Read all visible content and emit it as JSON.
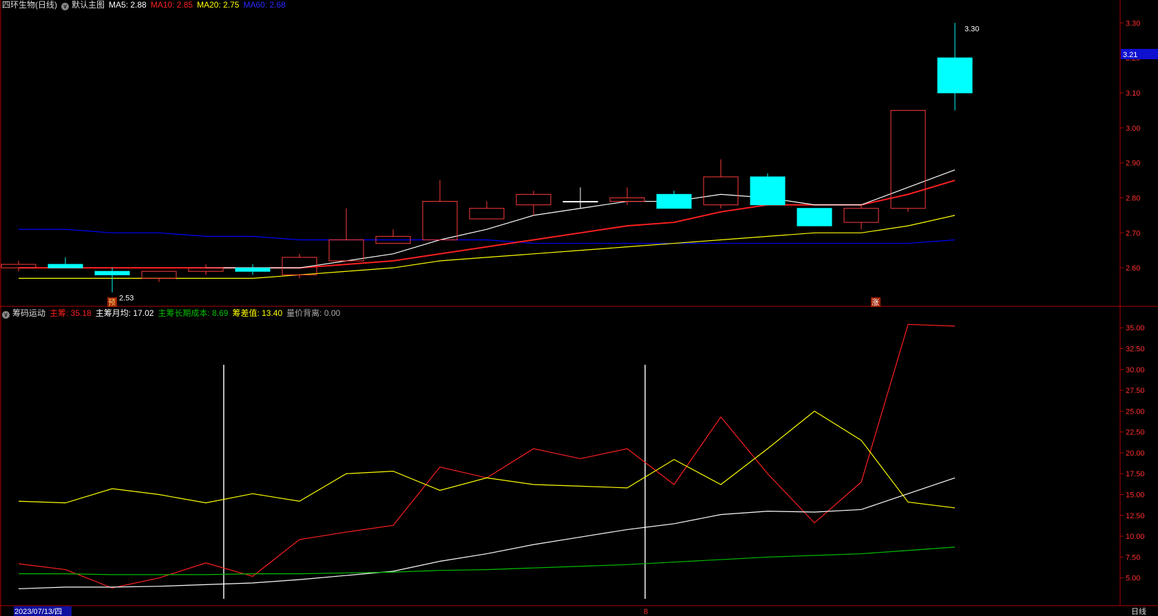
{
  "colors": {
    "bg": "#000000",
    "frame": "#b00000",
    "up": "#ff3b3b",
    "down": "#00ffff",
    "ma5": "#ffffff",
    "ma10": "#ff2020",
    "ma20": "#ffff00",
    "ma60": "#0000ff",
    "main_chip": "#ff2020",
    "monthly_avg": "#ffffff",
    "long_cost": "#00c000",
    "chip_diff": "#ffff00",
    "divergence": "#bbbbbb"
  },
  "header": {
    "title": "四环生物(日线)",
    "template": "默认主图",
    "ma5_label": "MA5: 2.88",
    "ma10_label": "MA10: 2.85",
    "ma20_label": "MA20: 2.75",
    "ma60_label": "MA60: 2.68"
  },
  "sub_header": {
    "indicator": "筹码运动",
    "main_chip_label": "主筹: 35.18",
    "monthly_avg_label": "主筹月均: 17.02",
    "long_cost_label": "主筹长期成本: 8.69",
    "chip_diff_label": "筹差值: 13.40",
    "divergence_label": "量价背离: 0.00"
  },
  "footer": {
    "start_date": "2023/07/13/四",
    "month_marker": "8",
    "period": "日线"
  },
  "markers": {
    "low_label": "2.53",
    "high_label": "3.30",
    "pre_tag": "预",
    "rise_tag": "涨",
    "current_price": "3.21"
  },
  "chart_data": [
    {
      "type": "candlestick",
      "title": "四环生物(日线)",
      "ylim": [
        2.5,
        3.33
      ],
      "y_ticks": [
        2.6,
        2.7,
        2.8,
        2.9,
        3.0,
        3.1,
        3.2,
        3.3
      ],
      "candles": [
        {
          "o": 2.6,
          "h": 2.62,
          "l": 2.59,
          "c": 2.61
        },
        {
          "o": 2.61,
          "h": 2.63,
          "l": 2.6,
          "c": 2.6
        },
        {
          "o": 2.59,
          "h": 2.6,
          "l": 2.53,
          "c": 2.58
        },
        {
          "o": 2.57,
          "h": 2.59,
          "l": 2.56,
          "c": 2.59
        },
        {
          "o": 2.59,
          "h": 2.61,
          "l": 2.58,
          "c": 2.6
        },
        {
          "o": 2.6,
          "h": 2.61,
          "l": 2.58,
          "c": 2.59
        },
        {
          "o": 2.58,
          "h": 2.64,
          "l": 2.57,
          "c": 2.63
        },
        {
          "o": 2.62,
          "h": 2.77,
          "l": 2.62,
          "c": 2.68
        },
        {
          "o": 2.67,
          "h": 2.71,
          "l": 2.67,
          "c": 2.69
        },
        {
          "o": 2.68,
          "h": 2.85,
          "l": 2.68,
          "c": 2.79
        },
        {
          "o": 2.74,
          "h": 2.79,
          "l": 2.74,
          "c": 2.77
        },
        {
          "o": 2.78,
          "h": 2.82,
          "l": 2.75,
          "c": 2.81
        },
        {
          "o": 2.79,
          "h": 2.83,
          "l": 2.77,
          "c": 2.79
        },
        {
          "o": 2.79,
          "h": 2.83,
          "l": 2.78,
          "c": 2.8
        },
        {
          "o": 2.81,
          "h": 2.82,
          "l": 2.77,
          "c": 2.77
        },
        {
          "o": 2.78,
          "h": 2.91,
          "l": 2.77,
          "c": 2.86
        },
        {
          "o": 2.86,
          "h": 2.87,
          "l": 2.78,
          "c": 2.78
        },
        {
          "o": 2.77,
          "h": 2.77,
          "l": 2.72,
          "c": 2.72
        },
        {
          "o": 2.73,
          "h": 2.78,
          "l": 2.71,
          "c": 2.77
        },
        {
          "o": 2.77,
          "h": 3.05,
          "l": 2.76,
          "c": 3.05
        },
        {
          "o": 3.2,
          "h": 3.3,
          "l": 3.05,
          "c": 3.1
        }
      ],
      "ma5": [
        null,
        null,
        null,
        null,
        2.6,
        2.6,
        2.6,
        2.62,
        2.64,
        2.68,
        2.71,
        2.75,
        2.77,
        2.79,
        2.79,
        2.81,
        2.8,
        2.78,
        2.78,
        2.83,
        2.88
      ],
      "ma10": [
        2.6,
        2.6,
        2.6,
        2.6,
        2.6,
        2.6,
        2.6,
        2.61,
        2.62,
        2.64,
        2.66,
        2.68,
        2.7,
        2.72,
        2.73,
        2.76,
        2.78,
        2.78,
        2.78,
        2.81,
        2.85
      ],
      "ma20": [
        2.57,
        2.57,
        2.57,
        2.57,
        2.57,
        2.57,
        2.58,
        2.59,
        2.6,
        2.62,
        2.63,
        2.64,
        2.65,
        2.66,
        2.67,
        2.68,
        2.69,
        2.7,
        2.7,
        2.72,
        2.75
      ],
      "ma60": [
        2.71,
        2.71,
        2.7,
        2.7,
        2.69,
        2.69,
        2.68,
        2.68,
        2.68,
        2.68,
        2.68,
        2.67,
        2.67,
        2.67,
        2.67,
        2.67,
        2.67,
        2.67,
        2.67,
        2.67,
        2.68
      ]
    },
    {
      "type": "line",
      "title": "筹码运动",
      "ylim": [
        2.5,
        36.5
      ],
      "y_ticks": [
        5.0,
        7.5,
        10.0,
        12.5,
        15.0,
        17.5,
        20.0,
        22.5,
        25.0,
        27.5,
        30.0,
        32.5,
        35.0
      ],
      "series": [
        {
          "name": "主筹",
          "values": [
            6.7,
            6.0,
            3.8,
            5.0,
            6.8,
            5.2,
            9.6,
            10.5,
            11.3,
            18.3,
            17.0,
            20.5,
            19.3,
            20.5,
            16.2,
            24.3,
            17.5,
            11.6,
            16.5,
            35.4,
            35.2
          ]
        },
        {
          "name": "主筹月均",
          "values": [
            3.7,
            3.9,
            3.9,
            4.0,
            4.2,
            4.4,
            4.8,
            5.3,
            5.8,
            7.0,
            7.9,
            9.0,
            9.9,
            10.8,
            11.5,
            12.6,
            13.0,
            12.9,
            13.2,
            15.1,
            17.0
          ]
        },
        {
          "name": "主筹长期成本",
          "values": [
            5.5,
            5.5,
            5.4,
            5.4,
            5.4,
            5.5,
            5.5,
            5.6,
            5.7,
            5.9,
            6.0,
            6.2,
            6.4,
            6.6,
            6.9,
            7.2,
            7.5,
            7.7,
            7.9,
            8.3,
            8.7
          ]
        },
        {
          "name": "筹差值",
          "values": [
            14.2,
            14.0,
            15.7,
            15.0,
            14.0,
            15.1,
            14.2,
            17.5,
            17.8,
            15.5,
            17.0,
            16.2,
            16.0,
            15.8,
            19.2,
            16.2,
            20.5,
            25.0,
            21.5,
            14.1,
            13.4
          ]
        }
      ],
      "divergence_bars_index": [
        4,
        13
      ]
    }
  ]
}
